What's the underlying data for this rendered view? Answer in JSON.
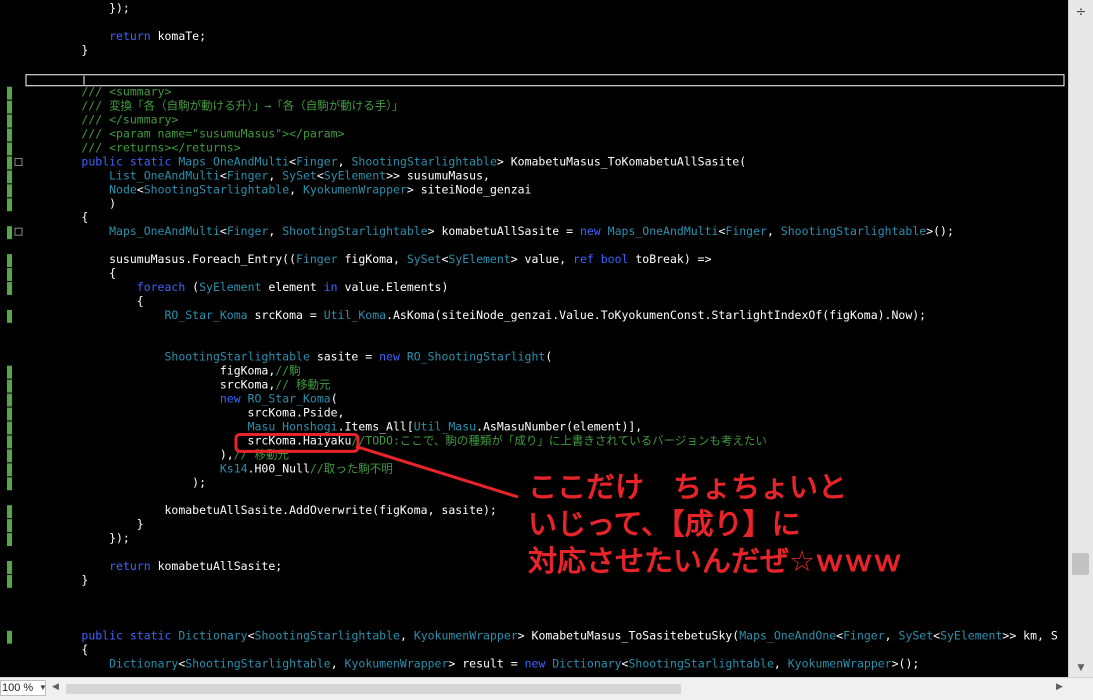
{
  "editor": {
    "lines": [
      {
        "t": "            });",
        "tokens": [
          [
            "            });",
            "#ffffff"
          ]
        ]
      },
      {
        "tokens": []
      },
      {
        "tokens": [
          [
            "            ",
            "#fff"
          ],
          [
            "return",
            "#3c64ff"
          ],
          [
            " komaTe;",
            "#ffffff"
          ]
        ]
      },
      {
        "tokens": [
          [
            "        }",
            "#ffffff"
          ]
        ]
      },
      {
        "tokens": []
      },
      {
        "tokens": []
      },
      {
        "tokens": [
          [
            "        /// <summary>",
            "#409b40"
          ]
        ]
      },
      {
        "tokens": [
          [
            "        /// 変換「各（自駒が動ける升）」→「各（自駒が動ける手）」",
            "#409b40"
          ]
        ]
      },
      {
        "tokens": [
          [
            "        /// </summary>",
            "#409b40"
          ]
        ]
      },
      {
        "tokens": [
          [
            "        /// <param name=\"susumuMasus\"></param>",
            "#409b40"
          ]
        ]
      },
      {
        "tokens": [
          [
            "        /// <returns></returns>",
            "#409b40"
          ]
        ]
      },
      {
        "tokens": [
          [
            "        ",
            "#fff"
          ],
          [
            "public",
            "#3c64ff"
          ],
          [
            " ",
            "#fff"
          ],
          [
            "static",
            "#3c64ff"
          ],
          [
            " ",
            "#fff"
          ],
          [
            "Maps_OneAndMulti",
            "#2b91af"
          ],
          [
            "<",
            "#fff"
          ],
          [
            "Finger",
            "#2b91af"
          ],
          [
            ", ",
            "#fff"
          ],
          [
            "ShootingStarlightable",
            "#2b91af"
          ],
          [
            "> KomabetuMasus_ToKomabetuAllSasite(",
            "#ffffff"
          ]
        ]
      },
      {
        "tokens": [
          [
            "            ",
            "#fff"
          ],
          [
            "List_OneAndMulti",
            "#2b91af"
          ],
          [
            "<",
            "#fff"
          ],
          [
            "Finger",
            "#2b91af"
          ],
          [
            ", ",
            "#fff"
          ],
          [
            "SySet",
            "#2b91af"
          ],
          [
            "<",
            "#fff"
          ],
          [
            "SyElement",
            "#2b91af"
          ],
          [
            ">> susumuMasus,",
            "#ffffff"
          ]
        ]
      },
      {
        "tokens": [
          [
            "            ",
            "#fff"
          ],
          [
            "Node",
            "#2b91af"
          ],
          [
            "<",
            "#fff"
          ],
          [
            "ShootingStarlightable",
            "#2b91af"
          ],
          [
            ", ",
            "#fff"
          ],
          [
            "KyokumenWrapper",
            "#2b91af"
          ],
          [
            "> siteiNode_genzai",
            "#ffffff"
          ]
        ]
      },
      {
        "tokens": [
          [
            "            )",
            "#ffffff"
          ]
        ]
      },
      {
        "tokens": [
          [
            "        {",
            "#ffffff"
          ]
        ]
      },
      {
        "tokens": [
          [
            "            ",
            "#fff"
          ],
          [
            "Maps_OneAndMulti",
            "#2b91af"
          ],
          [
            "<",
            "#fff"
          ],
          [
            "Finger",
            "#2b91af"
          ],
          [
            ", ",
            "#fff"
          ],
          [
            "ShootingStarlightable",
            "#2b91af"
          ],
          [
            "> komabetuAllSasite = ",
            "#fff"
          ],
          [
            "new",
            "#3c64ff"
          ],
          [
            " ",
            "#fff"
          ],
          [
            "Maps_OneAndMulti",
            "#2b91af"
          ],
          [
            "<",
            "#fff"
          ],
          [
            "Finger",
            "#2b91af"
          ],
          [
            ", ",
            "#fff"
          ],
          [
            "ShootingStarlightable",
            "#2b91af"
          ],
          [
            ">();",
            "#ffffff"
          ]
        ]
      },
      {
        "tokens": []
      },
      {
        "tokens": [
          [
            "            susumuMasus.Foreach_Entry((",
            "#fff"
          ],
          [
            "Finger",
            "#2b91af"
          ],
          [
            " figKoma, ",
            "#fff"
          ],
          [
            "SySet",
            "#2b91af"
          ],
          [
            "<",
            "#fff"
          ],
          [
            "SyElement",
            "#2b91af"
          ],
          [
            "> value, ",
            "#fff"
          ],
          [
            "ref",
            "#3c64ff"
          ],
          [
            " ",
            "#fff"
          ],
          [
            "bool",
            "#3c64ff"
          ],
          [
            " toBreak) =>",
            "#ffffff"
          ]
        ]
      },
      {
        "tokens": [
          [
            "            {",
            "#ffffff"
          ]
        ]
      },
      {
        "tokens": [
          [
            "                ",
            "#fff"
          ],
          [
            "foreach",
            "#3c64ff"
          ],
          [
            " (",
            "#fff"
          ],
          [
            "SyElement",
            "#2b91af"
          ],
          [
            " element ",
            "#fff"
          ],
          [
            "in",
            "#3c64ff"
          ],
          [
            " value.Elements)",
            "#ffffff"
          ]
        ]
      },
      {
        "tokens": [
          [
            "                {",
            "#ffffff"
          ]
        ]
      },
      {
        "tokens": [
          [
            "                    ",
            "#fff"
          ],
          [
            "RO_Star_Koma",
            "#2b91af"
          ],
          [
            " srcKoma = ",
            "#fff"
          ],
          [
            "Util_Koma",
            "#2b91af"
          ],
          [
            ".AsKoma(siteiNode_genzai.Value.ToKyokumenConst.StarlightIndexOf(figKoma).Now);",
            "#ffffff"
          ]
        ]
      },
      {
        "tokens": []
      },
      {
        "tokens": []
      },
      {
        "tokens": [
          [
            "                    ",
            "#fff"
          ],
          [
            "ShootingStarlightable",
            "#2b91af"
          ],
          [
            " sasite = ",
            "#fff"
          ],
          [
            "new",
            "#3c64ff"
          ],
          [
            " ",
            "#fff"
          ],
          [
            "RO_ShootingStarlight",
            "#2b91af"
          ],
          [
            "(",
            "#ffffff"
          ]
        ]
      },
      {
        "tokens": [
          [
            "                            figKoma,",
            "#fff"
          ],
          [
            "//駒",
            "#409b40"
          ]
        ]
      },
      {
        "tokens": [
          [
            "                            srcKoma,",
            "#fff"
          ],
          [
            "// 移動元",
            "#409b40"
          ]
        ]
      },
      {
        "tokens": [
          [
            "                            ",
            "#fff"
          ],
          [
            "new",
            "#3c64ff"
          ],
          [
            " ",
            "#fff"
          ],
          [
            "RO_Star_Koma",
            "#2b91af"
          ],
          [
            "(",
            "#ffffff"
          ]
        ]
      },
      {
        "tokens": [
          [
            "                                srcKoma.Pside,",
            "#ffffff"
          ]
        ]
      },
      {
        "tokens": [
          [
            "                                ",
            "#fff"
          ],
          [
            "Masu_Honshogi",
            "#2b91af"
          ],
          [
            ".Items_All[",
            "#fff"
          ],
          [
            "Util_Masu",
            "#2b91af"
          ],
          [
            ".AsMasuNumber(element)],",
            "#ffffff"
          ]
        ]
      },
      {
        "tokens": [
          [
            "                                srcKoma.Haiyaku",
            "#fff"
          ],
          [
            "//TODO:ここで、駒の種類が「成り」に上書きされているバージョンも考えたい",
            "#409b40"
          ]
        ]
      },
      {
        "tokens": [
          [
            "                            ),",
            "#fff"
          ],
          [
            "// 移動元",
            "#409b40"
          ]
        ]
      },
      {
        "tokens": [
          [
            "                            ",
            "#fff"
          ],
          [
            "Ks14",
            "#2b91af"
          ],
          [
            ".H00_Null",
            "#fff"
          ],
          [
            "//取った駒不明",
            "#409b40"
          ]
        ]
      },
      {
        "tokens": [
          [
            "                        );",
            "#ffffff"
          ]
        ]
      },
      {
        "tokens": []
      },
      {
        "tokens": [
          [
            "                    komabetuAllSasite.AddOverwrite(figKoma, sasite);",
            "#ffffff"
          ]
        ]
      },
      {
        "tokens": [
          [
            "                }",
            "#ffffff"
          ]
        ]
      },
      {
        "tokens": [
          [
            "            });",
            "#ffffff"
          ]
        ]
      },
      {
        "tokens": []
      },
      {
        "tokens": [
          [
            "            ",
            "#fff"
          ],
          [
            "return",
            "#3c64ff"
          ],
          [
            " komabetuAllSasite;",
            "#ffffff"
          ]
        ]
      },
      {
        "tokens": [
          [
            "        }",
            "#ffffff"
          ]
        ]
      },
      {
        "tokens": []
      },
      {
        "tokens": []
      },
      {
        "tokens": []
      },
      {
        "tokens": [
          [
            "        ",
            "#fff"
          ],
          [
            "public",
            "#3c64ff"
          ],
          [
            " ",
            "#fff"
          ],
          [
            "static",
            "#3c64ff"
          ],
          [
            " ",
            "#fff"
          ],
          [
            "Dictionary",
            "#2b91af"
          ],
          [
            "<",
            "#fff"
          ],
          [
            "ShootingStarlightable",
            "#2b91af"
          ],
          [
            ", ",
            "#fff"
          ],
          [
            "KyokumenWrapper",
            "#2b91af"
          ],
          [
            "> KomabetuMasus_ToSasitebetuSky(",
            "#fff"
          ],
          [
            "Maps_OneAndOne",
            "#2b91af"
          ],
          [
            "<",
            "#fff"
          ],
          [
            "Finger",
            "#2b91af"
          ],
          [
            ", ",
            "#fff"
          ],
          [
            "SySet",
            "#2b91af"
          ],
          [
            "<",
            "#fff"
          ],
          [
            "SyElement",
            "#2b91af"
          ],
          [
            ">> km, S",
            "#ffffff"
          ]
        ]
      },
      {
        "tokens": [
          [
            "        {",
            "#ffffff"
          ]
        ]
      },
      {
        "tokens": [
          [
            "            ",
            "#fff"
          ],
          [
            "Dictionary",
            "#2b91af"
          ],
          [
            "<",
            "#fff"
          ],
          [
            "ShootingStarlightable",
            "#2b91af"
          ],
          [
            ", ",
            "#fff"
          ],
          [
            "KyokumenWrapper",
            "#2b91af"
          ],
          [
            "> result = ",
            "#fff"
          ],
          [
            "new",
            "#3c64ff"
          ],
          [
            " ",
            "#fff"
          ],
          [
            "Dictionary",
            "#2b91af"
          ],
          [
            "<",
            "#fff"
          ],
          [
            "ShootingStarlightable",
            "#2b91af"
          ],
          [
            ", ",
            "#fff"
          ],
          [
            "KyokumenWrapper",
            "#2b91af"
          ],
          [
            ">();",
            "#ffffff"
          ]
        ]
      }
    ],
    "change_markers": [
      7,
      8,
      9,
      10,
      11,
      12,
      13,
      14,
      15,
      17,
      19,
      20,
      21,
      23,
      27,
      28,
      29,
      30,
      31,
      32,
      33,
      34,
      35,
      37,
      38,
      39,
      41,
      42,
      46
    ]
  },
  "annotation": {
    "lines": [
      "ここだけ　ちょちょいと",
      "いじって、【成り】に",
      "対応させたいんだぜ☆ｗｗｗ"
    ],
    "color": "#e8242a"
  },
  "zoom": {
    "value": "100 %"
  },
  "scroll": {
    "split_icon": "÷"
  }
}
